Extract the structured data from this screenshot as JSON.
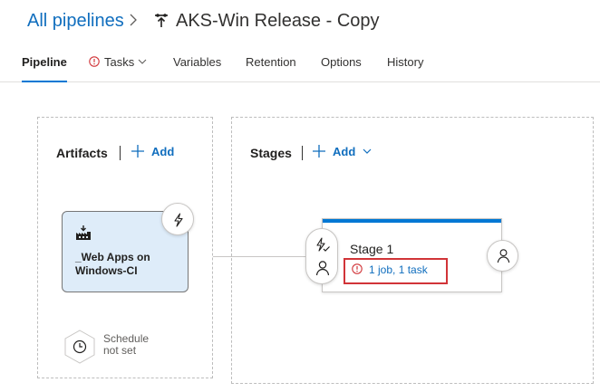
{
  "breadcrumb": {
    "root": "All pipelines",
    "title": "AKS-Win Release - Copy"
  },
  "tabs": [
    {
      "label": "Pipeline",
      "active": true
    },
    {
      "label": "Tasks",
      "warning": true,
      "dropdown": true
    },
    {
      "label": "Variables"
    },
    {
      "label": "Retention"
    },
    {
      "label": "Options"
    },
    {
      "label": "History"
    }
  ],
  "artifacts": {
    "title": "Artifacts",
    "add_label": "Add",
    "items": [
      {
        "name": "_Web Apps on Windows-CI",
        "icon": "build-artifact-icon"
      }
    ],
    "schedule": {
      "line1": "Schedule",
      "line2": "not set"
    }
  },
  "stages": {
    "title": "Stages",
    "add_label": "Add",
    "items": [
      {
        "name": "Stage 1",
        "tasks_summary": "1 job, 1 task",
        "warning": true
      }
    ]
  },
  "colors": {
    "accent": "#0078d4",
    "link": "#106ebe",
    "error": "#d13438",
    "artifact_bg": "#deecf9"
  }
}
